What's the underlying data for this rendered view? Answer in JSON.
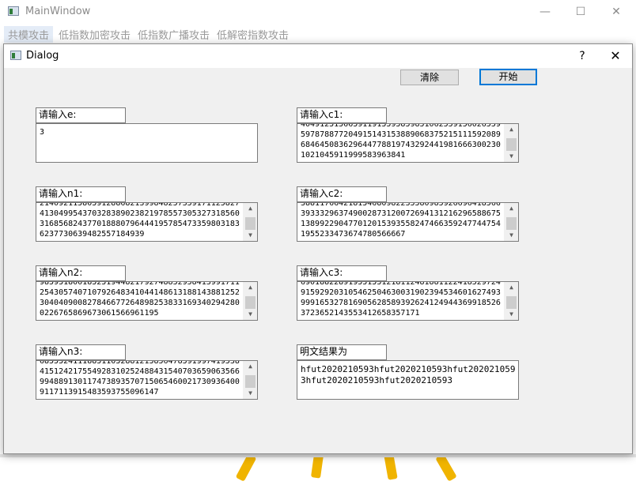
{
  "main_window": {
    "title": "MainWindow",
    "controls": {
      "minimize": "—",
      "maximize": "☐",
      "close": "✕"
    },
    "menu": [
      "共模攻击",
      "低指数加密攻击",
      "低指数广播攻击",
      "低解密指数攻击"
    ]
  },
  "dialog": {
    "title": "Dialog",
    "help": "?",
    "close": "✕",
    "buttons": {
      "clear": "清除",
      "start": "开始"
    },
    "fields": {
      "e": {
        "label": "请输入e:",
        "text": "3"
      },
      "c1": {
        "label": "请输入c1:",
        "text": "4049125156659119155958598510625591560265595978788772049151431538890683752151115920896846450836296447788197432924419816663002301021045911999583963841"
      },
      "n1": {
        "label": "请输入n1:",
        "text": "2140921158059128868213998482573591711258274130499543703283890238219785573053273185603168568243770188807964441957854733598031836237730639482557184939"
      },
      "c2": {
        "label": "请输入c2:",
        "text": "3881176642181546809822355809859266964185663933329637490028731200726941312162965886751389922904770120153935582474663592477447541955233473674780566667"
      },
      "n2": {
        "label": "请输入n2:",
        "text": "9859518001852519448217927488529584139917112543057407107926483410441486131881438812523040409008278466772648982538331693402942800226765869673061566961195"
      },
      "c3": {
        "label": "请输入c3:",
        "text": "6901882289195515512181124818811224185297249159292031054625046300319023945346016274939991653278169056285893926241249443699185263723652143553412658357171"
      },
      "n3": {
        "label": "请输入n3:",
        "text": "6855524111885110528812158564785919974195384151242175549283102524884315407036590635669948891301174738935707150654600217309364009117113915483593755096147"
      },
      "result": {
        "label": "明文结果为",
        "text": "hfut2020210593hfut2020210593hfut2020210593hfut2020210593hfut2020210593"
      }
    }
  }
}
